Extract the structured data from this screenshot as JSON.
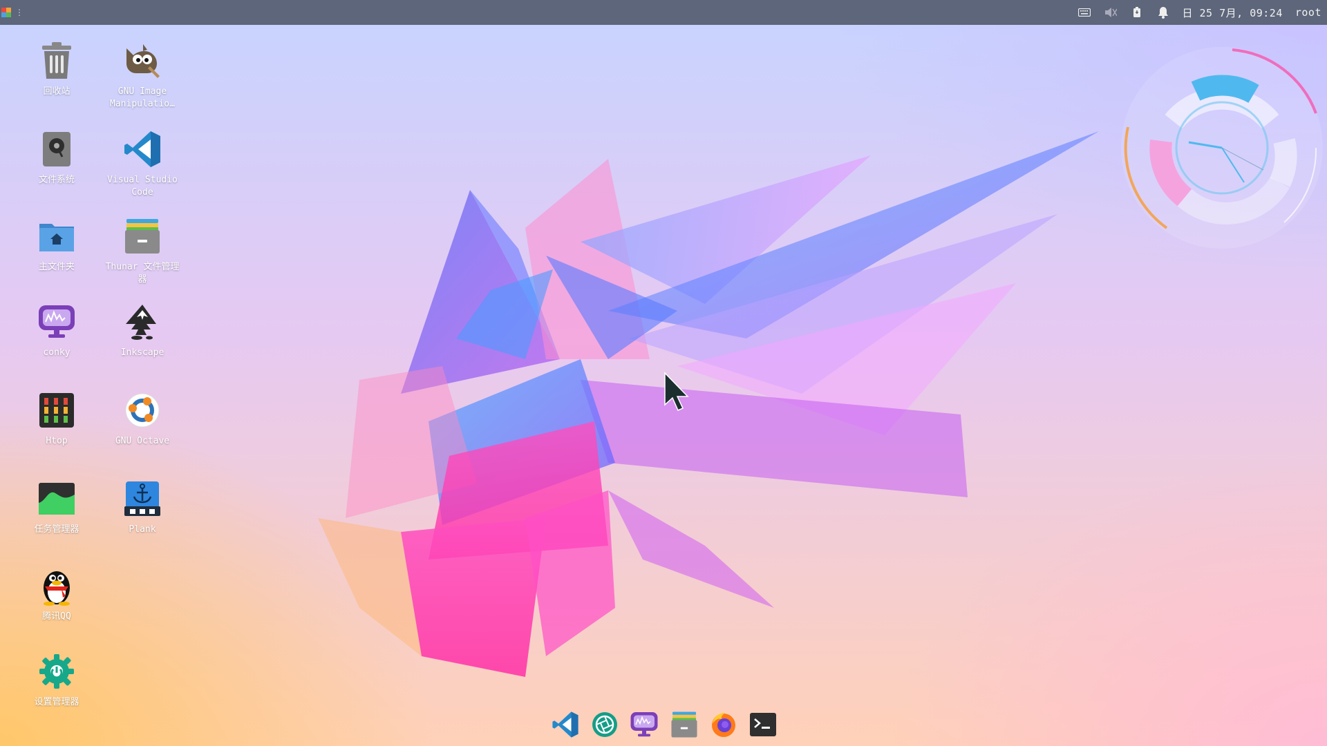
{
  "top_panel": {
    "clock": "日 25 7月, 09:24",
    "user": "root",
    "menu_dots": "⋮",
    "tray_icons": [
      "keyboard-icon",
      "volume-muted-icon",
      "battery-icon",
      "notification-bell-icon"
    ]
  },
  "desktop": {
    "icons": [
      {
        "name": "trash",
        "label": "回收站",
        "icon": "trash-icon"
      },
      {
        "name": "gimp",
        "label": "GNU Image Manipulatio…",
        "icon": "gimp-icon"
      },
      {
        "name": "filesystem",
        "label": "文件系统",
        "icon": "drive-icon"
      },
      {
        "name": "vscode",
        "label": "Visual Studio Code",
        "icon": "vscode-icon"
      },
      {
        "name": "home",
        "label": "主文件夹",
        "icon": "home-folder-icon"
      },
      {
        "name": "thunar",
        "label": "Thunar 文件管理器",
        "icon": "file-cabinet-icon"
      },
      {
        "name": "conky",
        "label": "conky",
        "icon": "conky-monitor-icon"
      },
      {
        "name": "inkscape",
        "label": "Inkscape",
        "icon": "inkscape-icon"
      },
      {
        "name": "htop",
        "label": "Htop",
        "icon": "htop-icon"
      },
      {
        "name": "octave",
        "label": "GNU Octave",
        "icon": "octave-icon"
      },
      {
        "name": "taskmanager",
        "label": "任务管理器",
        "icon": "task-manager-icon"
      },
      {
        "name": "plank",
        "label": "Plank",
        "icon": "plank-anchor-icon"
      },
      {
        "name": "qq",
        "label": "腾讯QQ",
        "icon": "qq-penguin-icon"
      },
      {
        "name": "settings",
        "label": "设置管理器",
        "icon": "settings-gear-icon"
      }
    ]
  },
  "dock": {
    "items": [
      "vscode-icon",
      "shutter-icon",
      "conky-monitor-icon",
      "file-cabinet-icon",
      "firefox-icon",
      "terminal-icon"
    ]
  },
  "colors": {
    "panel_bg": "#5d667a",
    "accent_blue": "#4fb9ef",
    "accent_pink": "#f48ad0",
    "accent_orange": "#f2a65a"
  }
}
